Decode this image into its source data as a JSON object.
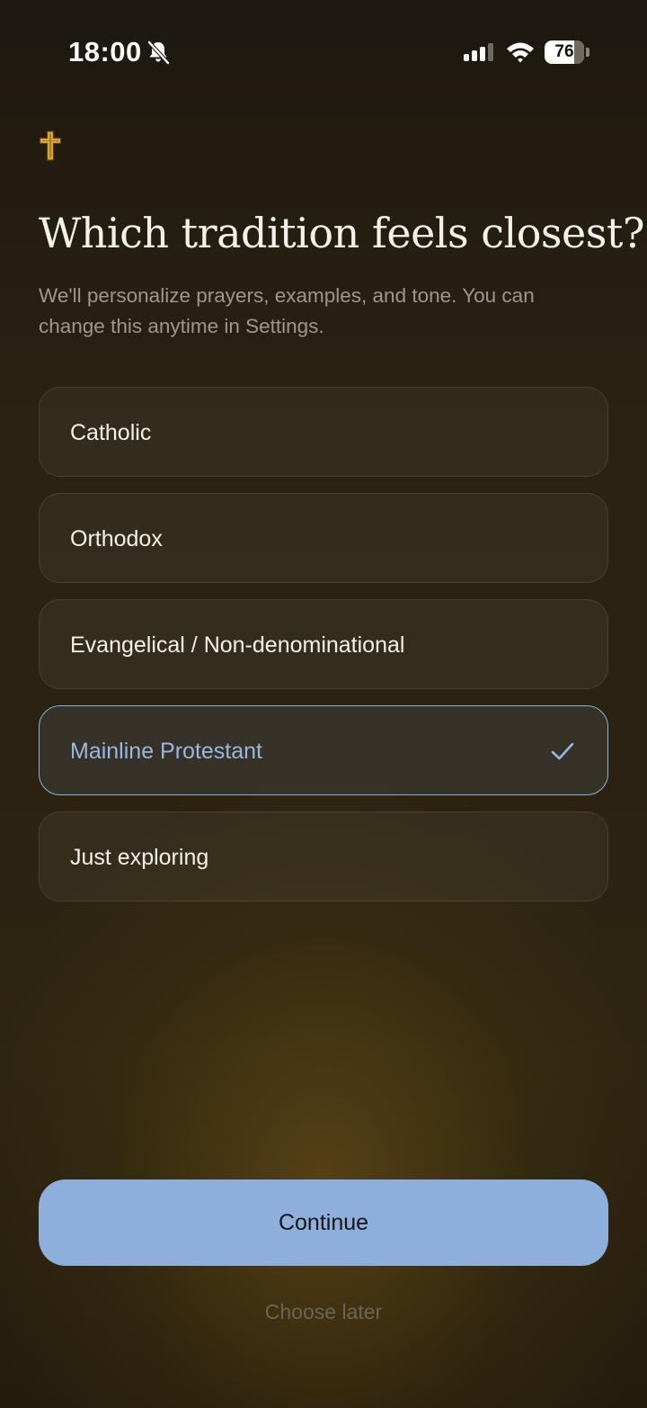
{
  "status_bar": {
    "time": "18:00",
    "battery_level": "76",
    "battery_fraction": 0.76,
    "icons": [
      "bell-slash-icon",
      "cellular-signal-icon",
      "wifi-icon",
      "battery-icon"
    ]
  },
  "header": {
    "icon": "cross-icon",
    "title": "Which tradition feels closest?",
    "subtitle": "We'll personalize prayers, examples, and tone. You can change this anytime in Settings."
  },
  "options": [
    {
      "label": "Catholic",
      "selected": false
    },
    {
      "label": "Orthodox",
      "selected": false
    },
    {
      "label": "Evangelical / Non-denominational",
      "selected": false
    },
    {
      "label": "Mainline Protestant",
      "selected": true
    },
    {
      "label": "Just exploring",
      "selected": false
    }
  ],
  "actions": {
    "continue_label": "Continue",
    "choose_later_label": "Choose later"
  },
  "colors": {
    "accent": "#8eaedb",
    "cross_gold": "#e0a93a",
    "background": "#2a2212"
  }
}
